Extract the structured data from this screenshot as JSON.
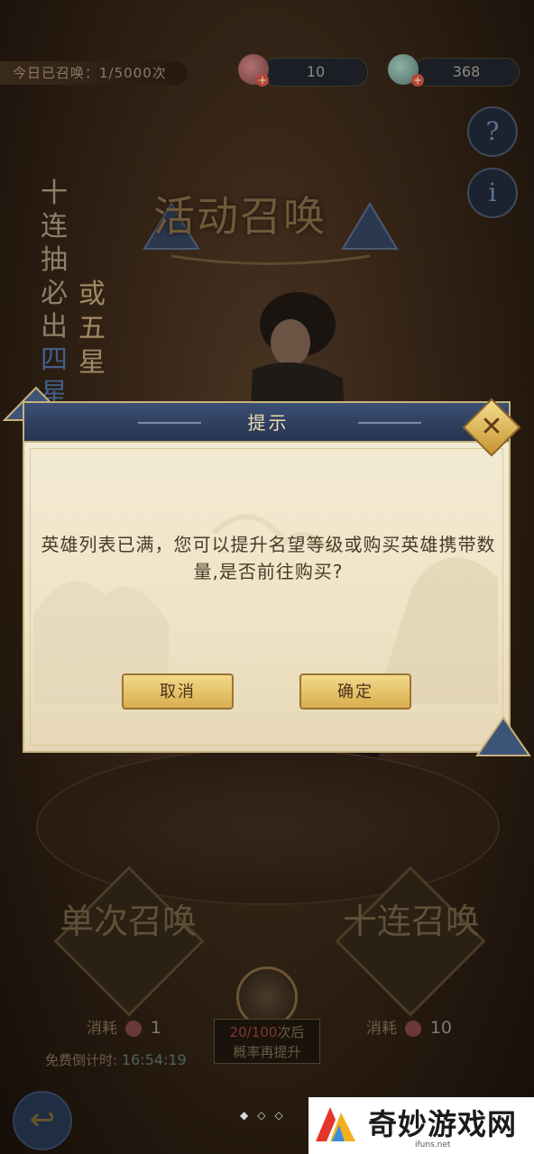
{
  "top": {
    "summon_count": "今日已召唤：1/5000次",
    "scroll_amount": "10",
    "jade_amount": "368",
    "plus": "+"
  },
  "buttons": {
    "help": "?",
    "info": "i",
    "back": "↩"
  },
  "side_text": {
    "line1": "十连抽必出",
    "hl": "四星",
    "line2": "或五星"
  },
  "banner_title": "活动召唤",
  "summon": {
    "single_label": "单次召唤",
    "single_cost_label": "消耗",
    "single_cost": "1",
    "ten_label": "十连召唤",
    "ten_cost_label": "消耗",
    "ten_cost": "10",
    "free_timer_label": "免费倒计时:",
    "free_timer": "16:54:19",
    "progress": "20/100",
    "progress_suffix": "次后",
    "progress_line2": "概率再提升"
  },
  "pager_dots": "◆◇◇",
  "dialog": {
    "title": "提示",
    "message": "英雄列表已满，您可以提升名望等级或购买英雄携带数量,是否前往购买?",
    "cancel": "取消",
    "confirm": "确定",
    "close": "✕"
  },
  "watermark": {
    "text": "奇妙游戏网",
    "url": "ifuns.net"
  }
}
